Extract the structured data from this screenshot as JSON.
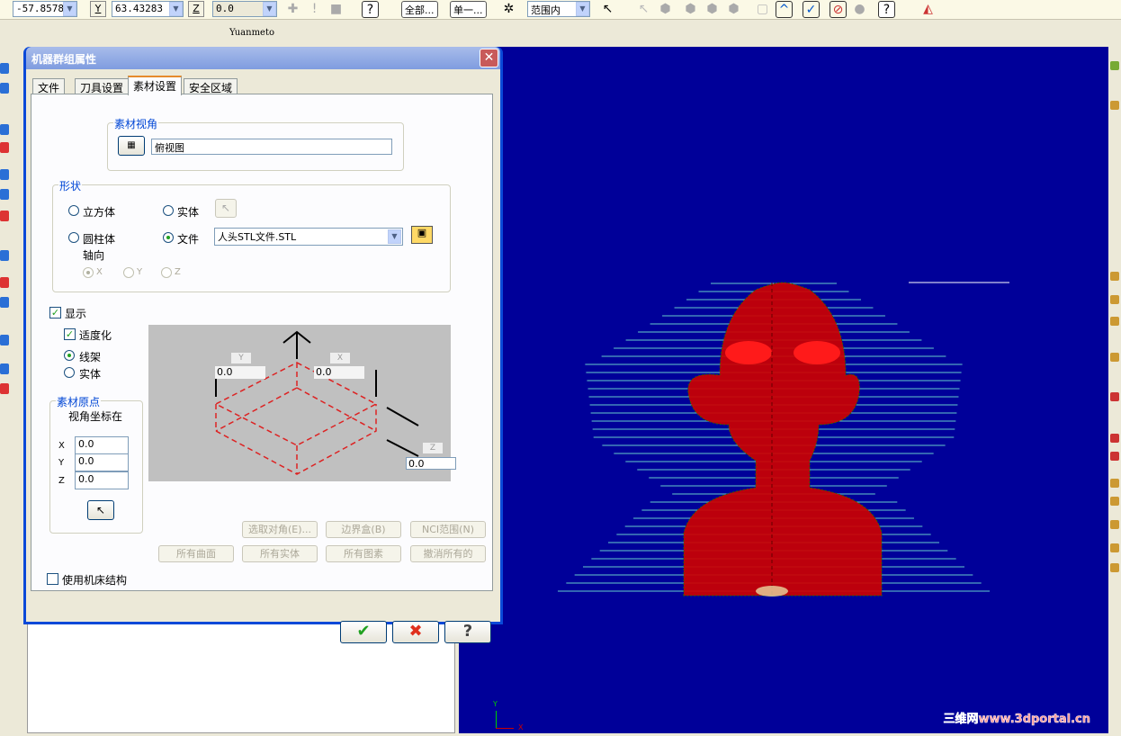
{
  "toolbar": {
    "x_value": "-57.8578",
    "y_label": "Y",
    "y_value": "63.43283",
    "z_label": "Z",
    "z_value": "0.0",
    "all_button": "全部...",
    "single_button": "单一...",
    "range_select": "范围内"
  },
  "window": {
    "title": "Yuanmeto"
  },
  "dialog": {
    "title": "机器群组属性",
    "close": "✕",
    "tabs": [
      {
        "label": "文件"
      },
      {
        "label": "刀具设置"
      },
      {
        "label": "素材设置",
        "active": true
      },
      {
        "label": "安全区域"
      }
    ],
    "view_group": {
      "label": "素材视角",
      "value": "俯视图"
    },
    "shape_group": {
      "label": "形状",
      "options": [
        {
          "label": "立方体",
          "selected": false
        },
        {
          "label": "实体",
          "selected": false
        },
        {
          "label": "圆柱体",
          "selected": false
        },
        {
          "label": "文件",
          "selected": true
        }
      ],
      "file_value": "人头STL文件.STL",
      "axis_label": "轴向",
      "axes": [
        {
          "label": "X",
          "selected": true
        },
        {
          "label": "Y",
          "selected": false
        },
        {
          "label": "Z",
          "selected": false
        }
      ]
    },
    "display": {
      "show_label": "显示",
      "show_checked": true,
      "fit_label": "适度化",
      "fit_checked": true,
      "wireframe_label": "线架",
      "wireframe_selected": true,
      "solid_label": "实体",
      "solid_selected": false
    },
    "preview": {
      "y_tag": "Y",
      "y_value": "0.0",
      "x_tag": "X",
      "x_value": "0.0",
      "z_tag": "Z",
      "z_value": "0.0"
    },
    "origin_group": {
      "label": "素材原点",
      "subtitle": "视角坐标在",
      "x_label": "X",
      "x_value": "0.0",
      "y_label": "Y",
      "y_value": "0.0",
      "z_label": "Z",
      "z_value": "0.0"
    },
    "buttons": {
      "select_corners": "选取对角(E)...",
      "bounding_box": "边界盒(B)",
      "nci_range": "NCI范围(N)",
      "all_surfaces": "所有曲面",
      "all_solids": "所有实体",
      "all_entities": "所有图素",
      "undo_all": "撤消所有的"
    },
    "use_machine_label": "使用机床结构",
    "use_machine_checked": false,
    "ok": "✔",
    "cancel": "✖",
    "help": "?"
  },
  "viewport": {
    "background": "#000099",
    "axis_y": "Y",
    "axis_x": "X",
    "watermark": "三维网www.3dportal.cn"
  }
}
